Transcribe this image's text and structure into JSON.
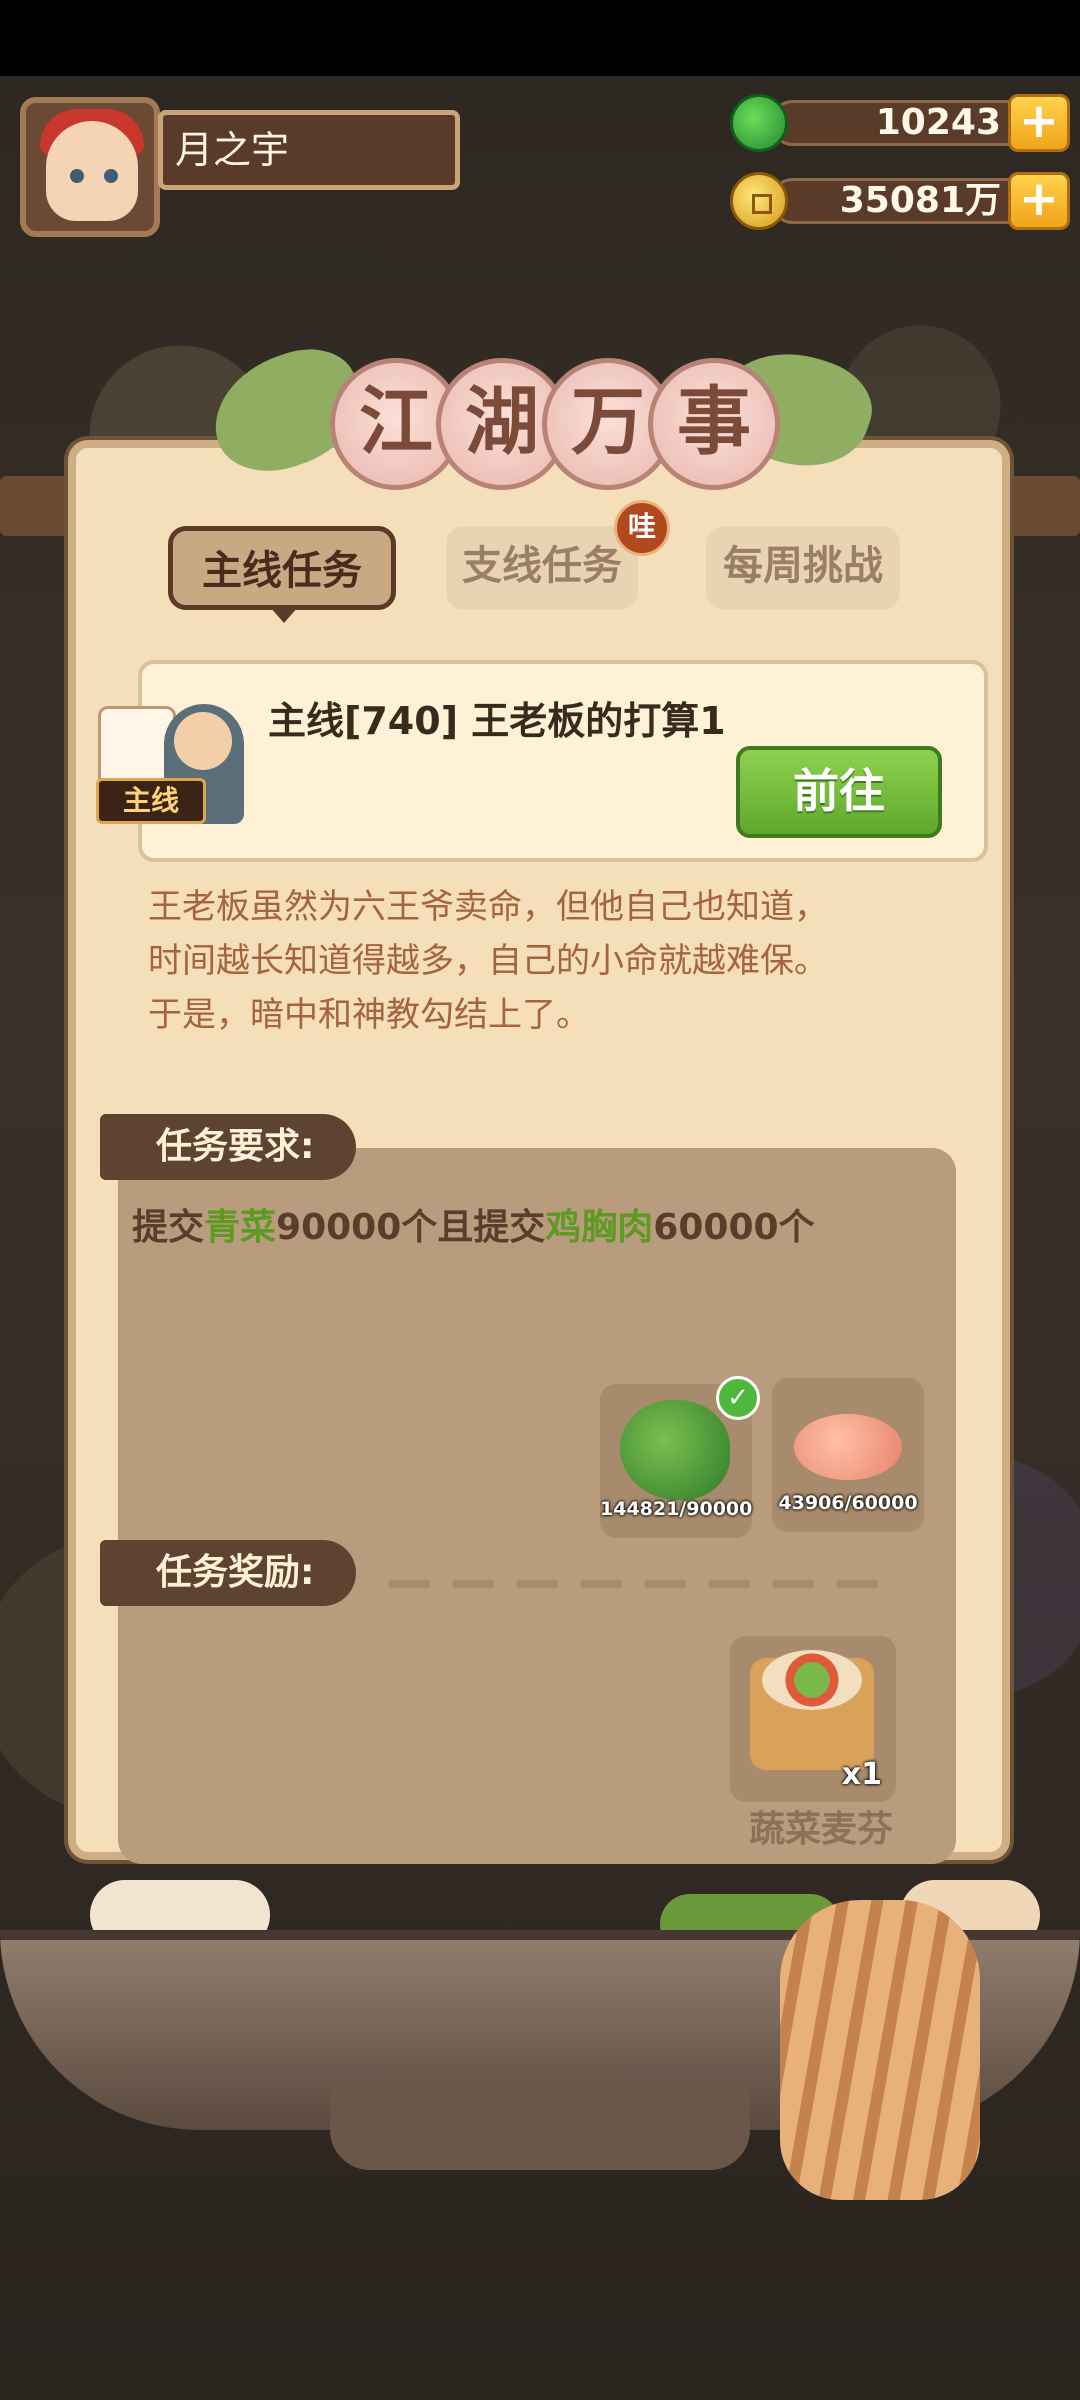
{
  "player": {
    "name": "月之宇"
  },
  "currencies": [
    {
      "icon": "jade-icon",
      "value": "10243",
      "plus": "+"
    },
    {
      "icon": "coin-icon",
      "value": "35081万",
      "plus": "+"
    }
  ],
  "panel": {
    "title_chars": [
      "江",
      "湖",
      "万",
      "事"
    ],
    "tabs": [
      {
        "label": "主线任务",
        "active": true
      },
      {
        "label": "支线任务",
        "active": false,
        "badge": "哇"
      },
      {
        "label": "每周挑战",
        "active": false
      }
    ]
  },
  "quest": {
    "tag": "主线",
    "title": "主线[740] 王老板的打算1",
    "go_label": "前往",
    "description": [
      "王老板虽然为六王爷卖命，但他自己也知道，",
      "时间越长知道得越多，自己的小命就越难保。",
      "于是，暗中和神教勾结上了。"
    ]
  },
  "requirements": {
    "label": "任务要求:",
    "text_parts": [
      "提交",
      "青菜",
      "90000个且提交",
      "鸡胸肉",
      "60000个"
    ],
    "items": [
      {
        "icon": "bok-choy-icon",
        "progress": "144821/90000",
        "completed": true,
        "check": "✓"
      },
      {
        "icon": "chicken-breast-icon",
        "progress": "43906/60000",
        "completed": false
      }
    ]
  },
  "rewards": {
    "label": "任务奖励:",
    "items": [
      {
        "icon": "veggie-muffin-icon",
        "qty": "x1",
        "name": "蔬菜麦芬"
      }
    ]
  },
  "colors": {
    "green_text": "#5d9a22",
    "go_button": "#6fb83a",
    "panel": "#f4dfba"
  }
}
